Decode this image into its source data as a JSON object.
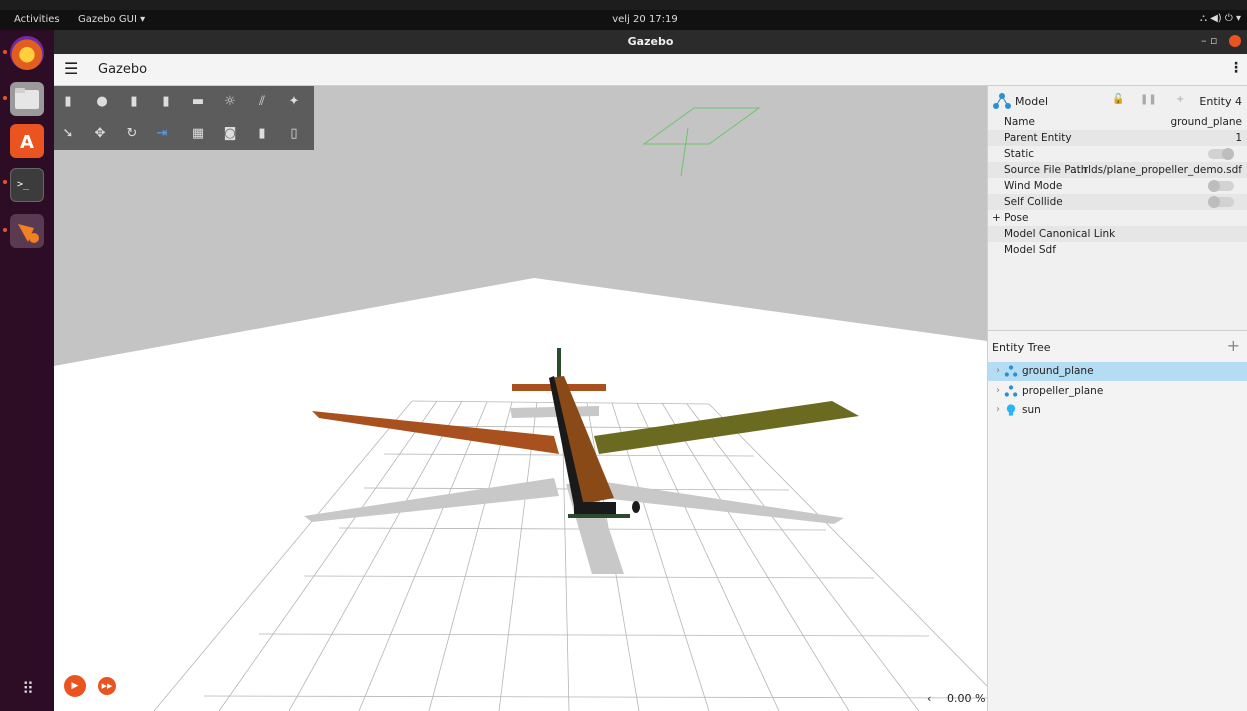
{
  "topbar": {
    "activities": "Activities",
    "app_menu": "Gazebo GUI ▾",
    "clock": "velj 20 17:19",
    "tray": "⛬ ◀) ⏻ ▾"
  },
  "window": {
    "title": "Gazebo",
    "controls": "–  ▫"
  },
  "app": {
    "title": "Gazebo",
    "menu_icon": "☰",
    "more_icon": "⋮"
  },
  "dock": {
    "items": [
      "firefox-icon",
      "files-icon",
      "app-center-icon",
      "terminal-icon",
      "gazebo-icon"
    ],
    "apps_icon": "⠿"
  },
  "toolbar": {
    "shapes": [
      "▮",
      "●",
      "▮",
      "▮",
      "▬",
      "☼",
      "⫽",
      "✦"
    ],
    "tools": [
      "➘",
      "✥",
      "↻",
      "⇥",
      "▦",
      "◙",
      "▮",
      "▯"
    ]
  },
  "sim": {
    "play_icon": "▶",
    "step_icon": "▶▶",
    "rtf_chevron": "‹",
    "rtf": "0.00 %"
  },
  "component_inspector": {
    "title": "Model",
    "lock_icon": "🔓",
    "pause_icon": "❚❚",
    "plus_icon": "+",
    "entity": "Entity 4",
    "properties": [
      {
        "key": "Name",
        "value": "ground_plane"
      },
      {
        "key": "Parent Entity",
        "value": "1"
      },
      {
        "key": "Static",
        "toggle": "on"
      },
      {
        "key": "Source File Path",
        "value": "...rlds/plane_propeller_demo.sdf"
      },
      {
        "key": "Wind Mode",
        "toggle": "off"
      },
      {
        "key": "Self Collide",
        "toggle": "off"
      },
      {
        "key": "+ Pose"
      },
      {
        "key": "Model Canonical Link"
      },
      {
        "key": "Model Sdf"
      }
    ]
  },
  "entity_tree": {
    "title": "Entity Tree",
    "add_icon": "+",
    "items": [
      {
        "label": "ground_plane",
        "icon": "model-icon",
        "selected": true
      },
      {
        "label": "propeller_plane",
        "icon": "model-icon",
        "selected": false
      },
      {
        "label": "sun",
        "icon": "light-icon",
        "selected": false
      }
    ]
  },
  "colors": {
    "accent": "#e95420",
    "selection": "#b4dcf2",
    "wing_left": "#a8501e",
    "wing_right": "#6a6a20",
    "fuselage": "#8a4a18"
  }
}
